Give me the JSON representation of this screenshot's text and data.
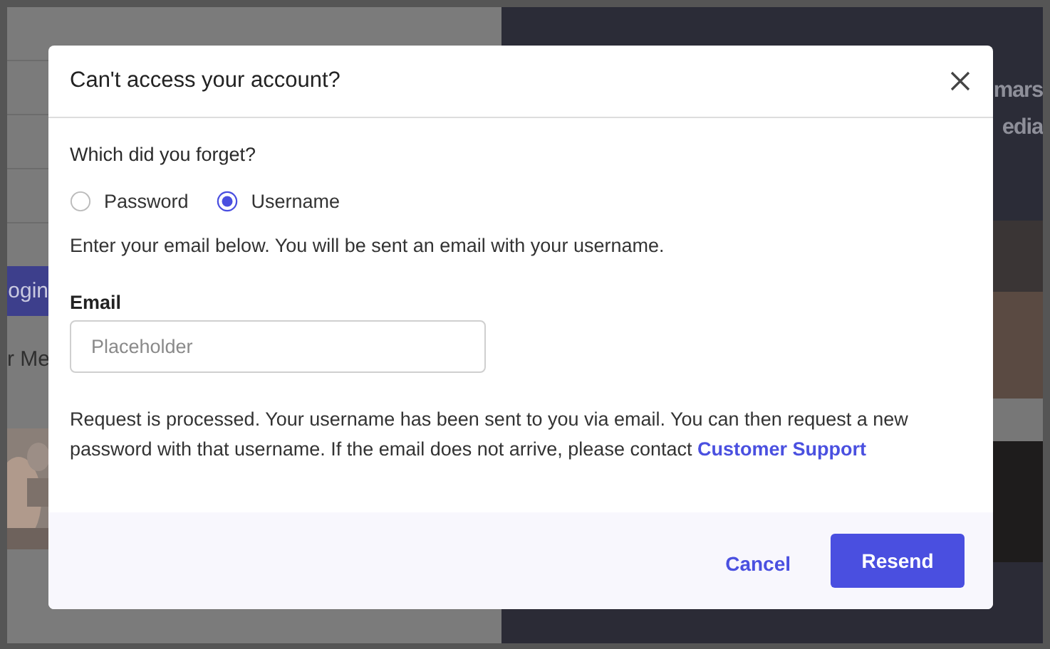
{
  "background": {
    "login_button": "ogin",
    "remember_text": "r Me",
    "hero_line_2": "mars",
    "hero_line_3": "edia"
  },
  "dialog": {
    "title": "Can't access your account?",
    "question": "Which did you forget?",
    "options": [
      {
        "label": "Password",
        "selected": false
      },
      {
        "label": "Username",
        "selected": true
      }
    ],
    "instruction": "Enter your email below. You will be sent an email with your username.",
    "email": {
      "label": "Email",
      "placeholder": "Placeholder"
    },
    "message": "Request is processed. Your username has been sent to you via email. You can then request a new password with that username. If the email does not arrive, please contact",
    "support_link": "Customer Support",
    "buttons": [
      {
        "label": "Cancel",
        "kind": "link"
      },
      {
        "label": "Resend",
        "kind": "primary"
      }
    ]
  }
}
